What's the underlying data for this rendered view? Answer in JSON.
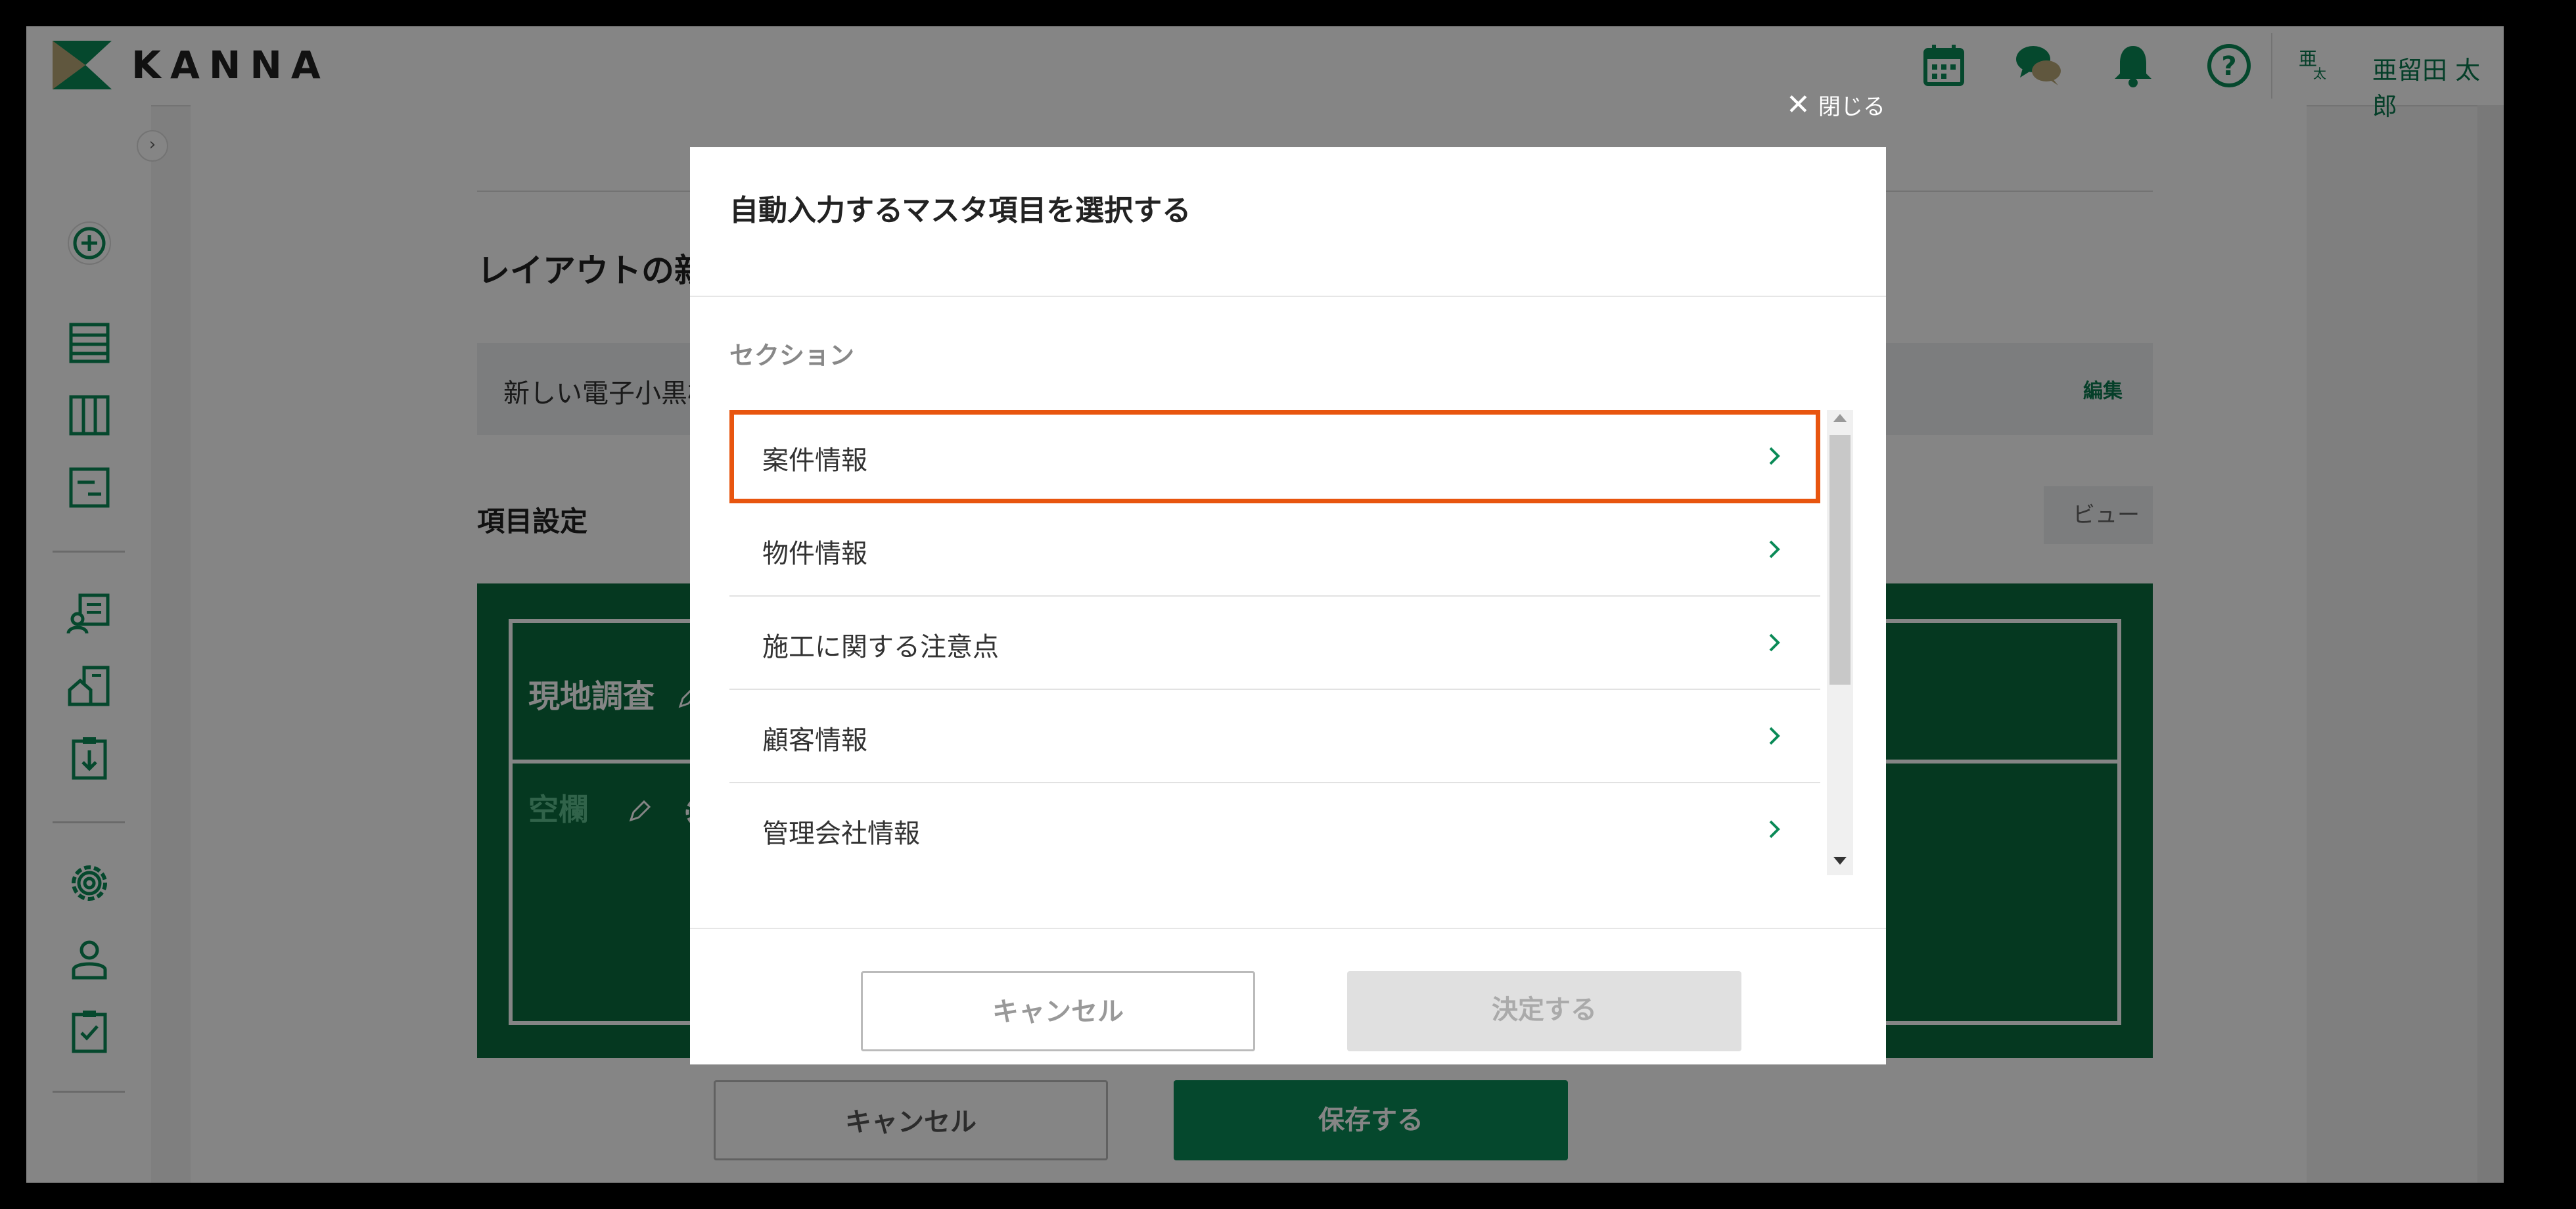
{
  "header": {
    "logo_text": "KANNA",
    "user_avatar_text": "亜",
    "user_avatar_subtext": "太",
    "user_name": "亜留田 太郎",
    "icons": [
      "calendar-icon",
      "chat-icon",
      "bell-icon",
      "help-icon"
    ]
  },
  "sidebar": {
    "collapse_label": "›",
    "icons": [
      "add-icon",
      "list-icon",
      "board-icon",
      "document-icon",
      "project-icon",
      "building-icon",
      "download-icon",
      "settings-icon",
      "user-icon",
      "task-icon"
    ]
  },
  "content": {
    "page_title": "レイアウトの新規作成",
    "layout_name": "新しい電子小黒板レイアウト",
    "edit_label": "編集",
    "section_label": "項目設定",
    "preview_label": "ビュー",
    "board": {
      "label": "現地調査",
      "blank_label": "空欄"
    },
    "cancel_label": "キャンセル",
    "save_label": "保存する"
  },
  "modal": {
    "close_label": "閉じる",
    "title": "自動入力するマスタ項目を選択する",
    "section_label": "セクション",
    "items": [
      {
        "label": "案件情報",
        "selected": true
      },
      {
        "label": "物件情報",
        "selected": false
      },
      {
        "label": "施工に関する注意点",
        "selected": false
      },
      {
        "label": "顧客情報",
        "selected": false
      },
      {
        "label": "管理会社情報",
        "selected": false
      }
    ],
    "cancel_label": "キャンセル",
    "confirm_label": "決定する"
  },
  "colors": {
    "brand_green": "#0a8a57",
    "board_green": "#0b6b3f",
    "selection_orange": "#e8550f"
  }
}
